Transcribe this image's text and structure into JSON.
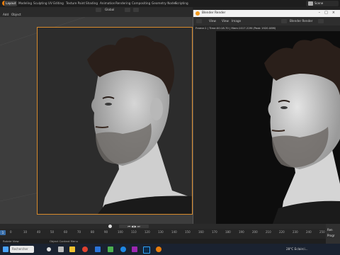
{
  "menubar": {
    "workspaces": [
      "Layout",
      "Modeling",
      "Sculpting",
      "UV Editing",
      "Texture Paint",
      "Shading",
      "Animation",
      "Rendering",
      "Compositing",
      "Geometry Nodes",
      "Scripting"
    ],
    "active_workspace": "Layout",
    "scene": "Scene"
  },
  "viewport_header": {
    "menu": [
      "Add",
      "Object"
    ],
    "transform": "Global"
  },
  "render_window": {
    "title": "Blender Render",
    "menu": [
      "View",
      "View",
      "Image"
    ],
    "slot": "Blender Render",
    "info": "Frame:1 | Time:00:18.70 | Mem:1017.22M (Peak 1920.08M)"
  },
  "timeline": {
    "ticks": [
      "0",
      "10",
      "40",
      "50",
      "60",
      "70",
      "80",
      "90",
      "100",
      "110",
      "120",
      "130",
      "140",
      "150",
      "160",
      "170",
      "180",
      "190",
      "200",
      "210",
      "220",
      "230",
      "240",
      "250"
    ],
    "current_frame": "1"
  },
  "status": {
    "left": "Rotate View",
    "middle": "Object Context Menu"
  },
  "right_panel": {
    "label": "Ren",
    "sub": "Progr"
  },
  "taskbar": {
    "weather": "28°C  Eclairci...",
    "search_placeholder": "Rechercher"
  },
  "colors": {
    "accent": "#d88a2c",
    "selection": "#3a6ea8"
  }
}
